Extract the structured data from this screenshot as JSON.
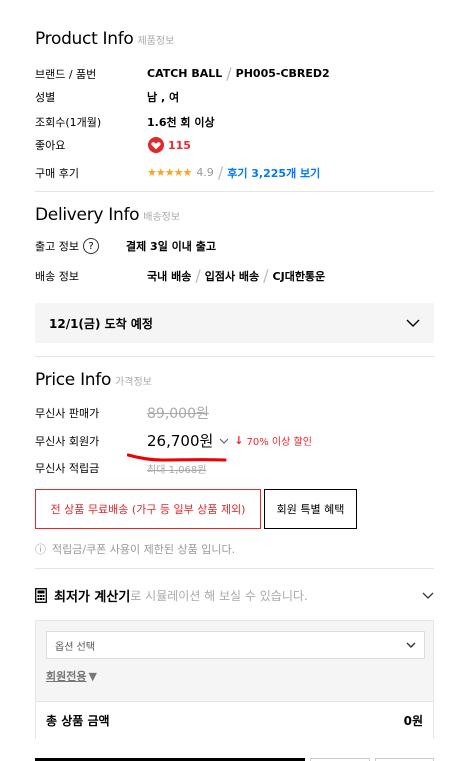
{
  "product_info": {
    "title": "Product Info",
    "subtitle": "제품정보",
    "rows": {
      "brand_label": "브랜드 / 품번",
      "brand": "CATCH BALL",
      "brand_sep": "/",
      "sku": "PH005-CBRED2",
      "gender_label": "성별",
      "gender": "남 , 여",
      "views_label": "조회수(1개월)",
      "views": "1.6천 회 이상",
      "likes_label": "좋아요",
      "likes": "115",
      "review_label": "구매 후기",
      "stars": "★★★★★",
      "rating": "4.9",
      "review_sep": "/",
      "review_link": "후기 3,225개 보기"
    }
  },
  "delivery_info": {
    "title": "Delivery Info",
    "subtitle": "배송정보",
    "ship_label": "출고 정보",
    "help_glyph": "?",
    "ship_value": "결제 3일 이내 출고",
    "delivery_label": "배송 정보",
    "delivery_parts": [
      "국내 배송",
      "입점사 배송",
      "CJ대한통운"
    ],
    "delivery_sep": "/",
    "arrival": "12/1(금) 도착 예정"
  },
  "price_info": {
    "title": "Price Info",
    "subtitle": "가격정보",
    "sale_label": "무신사 판매가",
    "sale_price": "89,000원",
    "member_label": "무신사 회원가",
    "member_price": "26,700원",
    "discount_arrow": "↓",
    "discount": "70% 이상 할인",
    "points_label": "무신사 적립금",
    "points": "최대 1,068원",
    "free_shipping_btn": "전 상품 무료배송 (가구 등 일부 상품 제외)",
    "member_benefit_btn": "회원 특별 혜택",
    "notice_icon": "ⓘ",
    "notice": "적립금/쿠폰 사용이 제한된 상품 입니다."
  },
  "calculator": {
    "title": "최저가 계산기",
    "desc": "로 시뮬레이션 해 보실 수 있습니다.",
    "option_placeholder": "옵션 선택",
    "member_only": "회원전용",
    "member_only_arrow": "▼",
    "total_label": "총 상품 금액",
    "total_value": "0원"
  },
  "colors": {
    "accent_red": "#f0282f",
    "link_blue": "#0078ff",
    "star": "#f5a623"
  },
  "icons": [
    "heart-icon",
    "help-icon",
    "chevron-down-icon",
    "info-icon",
    "calculator-icon"
  ]
}
